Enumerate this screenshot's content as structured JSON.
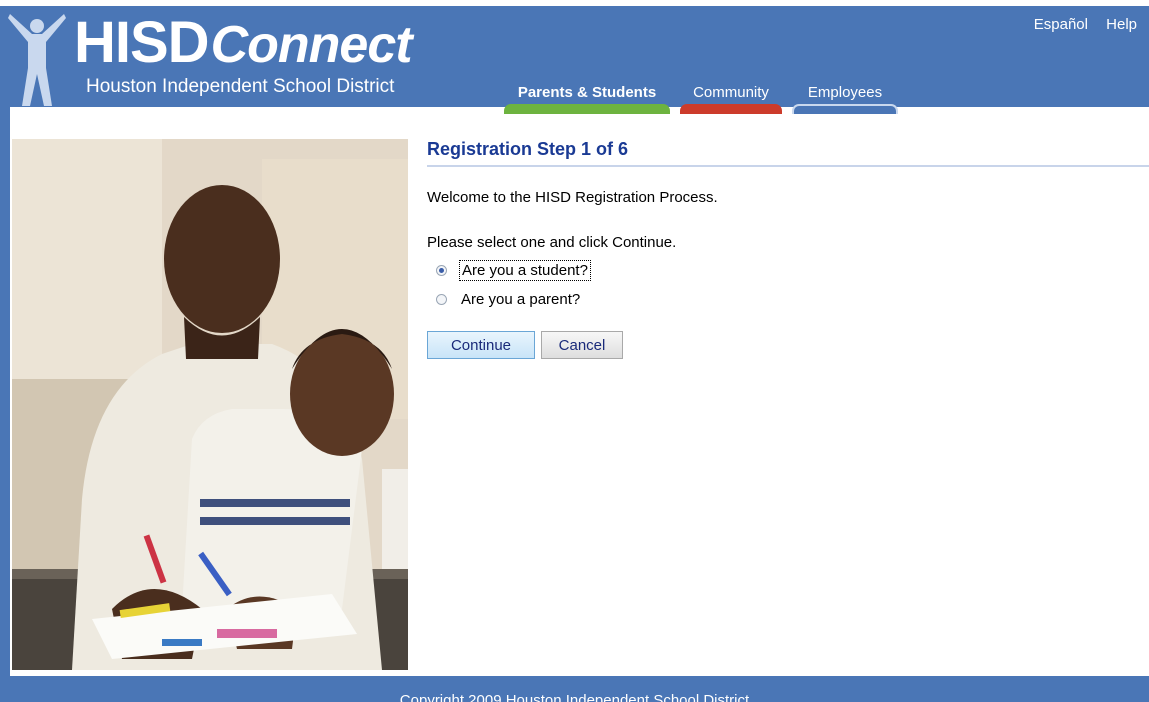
{
  "header": {
    "logo_primary": "HISD",
    "logo_secondary": "Connect",
    "logo_subtitle": "Houston Independent School District",
    "util_links": [
      "Español",
      "Help"
    ],
    "tabs": [
      {
        "label": "Parents & Students",
        "color": "#6db33f",
        "active": true
      },
      {
        "label": "Community",
        "color": "#cc3b2b",
        "active": false
      },
      {
        "label": "Employees",
        "color": "#4a76b6",
        "active": false
      }
    ]
  },
  "main": {
    "title": "Registration Step 1 of 6",
    "welcome": "Welcome to the HISD Registration Process.",
    "instruction": "Please select one and click Continue.",
    "options": [
      {
        "label": "Are you a student?",
        "selected": true
      },
      {
        "label": "Are you a parent?",
        "selected": false
      }
    ],
    "continue_label": "Continue",
    "cancel_label": "Cancel"
  },
  "footer": {
    "copyright": "Copyright 2009 Houston Independent School District"
  },
  "colors": {
    "brand_blue": "#4a76b6",
    "title_blue": "#1a3a94"
  },
  "icons": {
    "logo_figure": "person-arms-raised-icon"
  }
}
